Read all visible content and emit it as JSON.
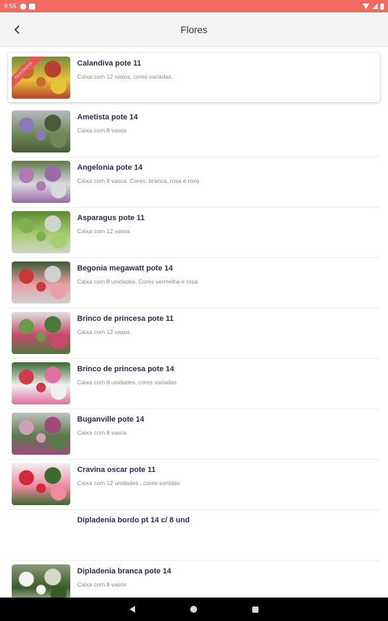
{
  "status_bar": {
    "time": "9:56"
  },
  "app_bar": {
    "title": "Flores"
  },
  "featured_ribbon": "DESTAQUE",
  "items": [
    {
      "name": "Calandiva pote 11",
      "desc": "Caixa com 12 vasos, cores variadas.",
      "featured": true,
      "thumb_colors": [
        "#c56b2d",
        "#e8c23a",
        "#7a8b3e",
        "#b8402e"
      ]
    },
    {
      "name": "Ametista pote 14",
      "desc": "Caixa com 8 vasos",
      "thumb_colors": [
        "#8c7ab8",
        "#6f8a58",
        "#b8b8c0",
        "#4c5a3a"
      ]
    },
    {
      "name": "Angelonia pote 14",
      "desc": "Caixa com 8 vasos. Cores: branca, rosa e roxa",
      "thumb_colors": [
        "#b07ab0",
        "#d8d8e0",
        "#5d7a45",
        "#9b6aa8"
      ]
    },
    {
      "name": "Asparagus pote 11",
      "desc": "Caixa com 12 vasos",
      "thumb_colors": [
        "#7fb050",
        "#a8cc70",
        "#5a8a35",
        "#cfd4c8"
      ]
    },
    {
      "name": "Begonia megawatt pote 14",
      "desc": "Caixa com 8 unidades. Cores vermelha e rosa",
      "thumb_colors": [
        "#c83a3a",
        "#e8a0a8",
        "#3a5a32",
        "#d0d0d0"
      ]
    },
    {
      "name": "Brinco de princesa pote 11",
      "desc": "Caixa com 12 vasos",
      "thumb_colors": [
        "#6a9a4a",
        "#c84a6a",
        "#e0e0e0",
        "#4a7a3a"
      ]
    },
    {
      "name": "Brinco de princesa pote 14",
      "desc": "Caixa com 8 unidades, cores variadas",
      "thumb_colors": [
        "#d03a4a",
        "#f0f0f0",
        "#3a6a30",
        "#e070a0"
      ]
    },
    {
      "name": "Buganville pote 14",
      "desc": "Caixa com 8 vasos",
      "thumb_colors": [
        "#d0a0b8",
        "#5a7a4a",
        "#c0c0c0",
        "#a04a7a"
      ]
    },
    {
      "name": "Cravina oscar pote 11",
      "desc": "Caixa com 12 unidades , cores sortidas",
      "thumb_colors": [
        "#d02a3a",
        "#f08aa0",
        "#f0f0f0",
        "#3a6a30"
      ]
    },
    {
      "name": "Dipladenia bordo pt 14 c/ 8 und",
      "desc": "",
      "no_image": true
    },
    {
      "name": "Dipladenia branca pote 14",
      "desc": "Caixa com 8 vasos",
      "thumb_colors": [
        "#f4f4f0",
        "#3a5a2a",
        "#8a9a7a",
        "#d8d8c8"
      ]
    }
  ]
}
